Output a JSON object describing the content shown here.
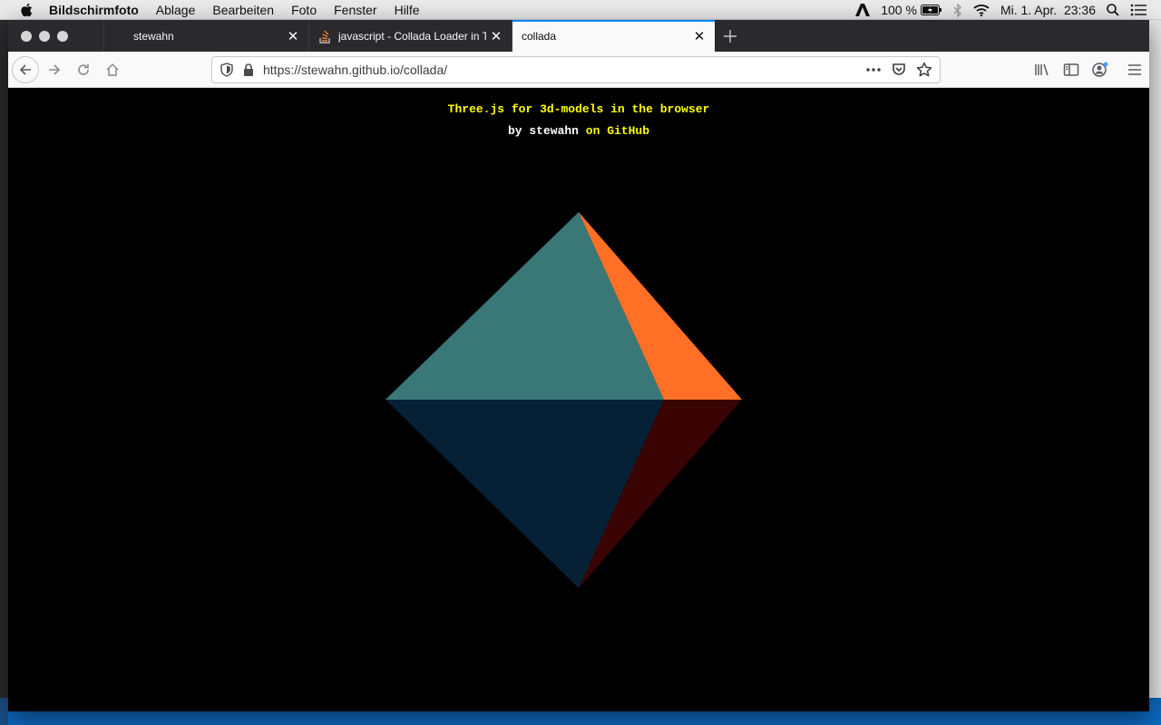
{
  "menubar": {
    "app_name": "Bildschirmfoto",
    "items": [
      "Ablage",
      "Bearbeiten",
      "Foto",
      "Fenster",
      "Hilfe"
    ],
    "battery": "100 %",
    "clock": "Mi. 1. Apr.  23:36"
  },
  "tabs": [
    {
      "title": "stewahn",
      "active": false
    },
    {
      "title": "javascript - Collada Loader in Th",
      "active": false
    },
    {
      "title": "collada",
      "active": true
    }
  ],
  "navbar": {
    "url": "https://stewahn.github.io/collada/"
  },
  "page": {
    "headline": "Three.js for 3d-models in the browser",
    "byline_prefix": "by stewahn",
    "byline_link": "on GitHub",
    "background": "#000000",
    "model": {
      "name": "octahedron",
      "face_colors": {
        "upper_left": "#3a7878",
        "upper_right": "#ff6f26",
        "lower_left": "#062135",
        "lower_right": "#3a0404"
      }
    }
  },
  "colors": {
    "accent_blue": "#0a84ff",
    "headline_yellow": "#ffff00"
  }
}
